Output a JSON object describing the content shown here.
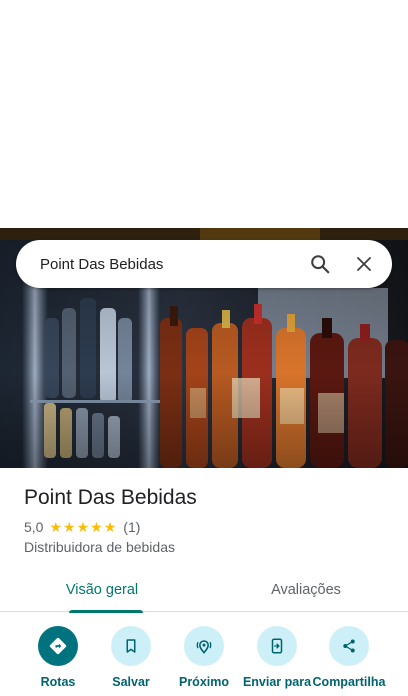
{
  "search": {
    "query": "Point Das Bebidas"
  },
  "place": {
    "title": "Point Das Bebidas",
    "rating_value": "5,0",
    "stars": [
      "★",
      "★",
      "★",
      "★",
      "★"
    ],
    "review_count": "(1)",
    "category": "Distribuidora de bebidas"
  },
  "tabs": [
    {
      "label": "Visão geral",
      "active": true
    },
    {
      "label": "Avaliações",
      "active": false
    }
  ],
  "actions": [
    {
      "label": "Rotas",
      "icon": "directions-icon"
    },
    {
      "label": "Salvar",
      "icon": "bookmark-icon"
    },
    {
      "label": "Próximo",
      "icon": "nearby-icon"
    },
    {
      "label": "Enviar para",
      "icon": "send-to-phone-icon"
    },
    {
      "label": "Compartilha",
      "icon": "share-icon"
    }
  ],
  "colors": {
    "accent": "#00796b",
    "star": "#fbbc04",
    "action_bg": "#cdeff7",
    "primary_action_bg": "#00737e"
  }
}
